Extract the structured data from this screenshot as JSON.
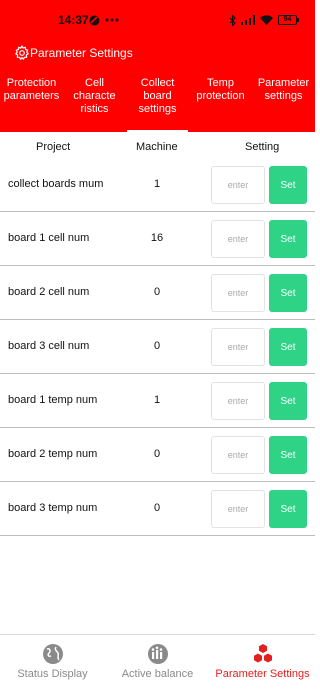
{
  "status_bar": {
    "time": "14:37",
    "battery": "94"
  },
  "header": {
    "title": "Parameter Settings"
  },
  "tabs": [
    {
      "lines": [
        "Protection",
        "parameters"
      ]
    },
    {
      "lines": [
        "Cell characte",
        "ristics"
      ]
    },
    {
      "lines": [
        "Collect",
        "board",
        "settings"
      ]
    },
    {
      "lines": [
        "Temp",
        "protection"
      ]
    },
    {
      "lines": [
        "Parameter",
        "settings"
      ]
    }
  ],
  "active_tab": 2,
  "table": {
    "headers": {
      "project": "Project",
      "machine": "Machine",
      "setting": "Setting"
    },
    "rows": [
      {
        "label": "collect boards mum",
        "value": "1",
        "placeholder": "enter",
        "button": "Set"
      },
      {
        "label": "board 1 cell num",
        "value": "16",
        "placeholder": "enter",
        "button": "Set"
      },
      {
        "label": "board 2 cell num",
        "value": "0",
        "placeholder": "enter",
        "button": "Set"
      },
      {
        "label": "board 3 cell num",
        "value": "0",
        "placeholder": "enter",
        "button": "Set"
      },
      {
        "label": "board 1 temp num",
        "value": "1",
        "placeholder": "enter",
        "button": "Set"
      },
      {
        "label": "board 2 temp num",
        "value": "0",
        "placeholder": "enter",
        "button": "Set"
      },
      {
        "label": "board 3 temp num",
        "value": "0",
        "placeholder": "enter",
        "button": "Set"
      }
    ]
  },
  "bottom_nav": {
    "items": [
      {
        "label": "Status Display",
        "icon": "globe-icon"
      },
      {
        "label": "Active balance",
        "icon": "balance-icon"
      },
      {
        "label": "Parameter Settings",
        "icon": "cubes-icon"
      }
    ],
    "active": 2
  },
  "colors": {
    "header_red": "#ff0000",
    "set_button_green": "#2ed386",
    "active_nav_red": "#e32020"
  }
}
